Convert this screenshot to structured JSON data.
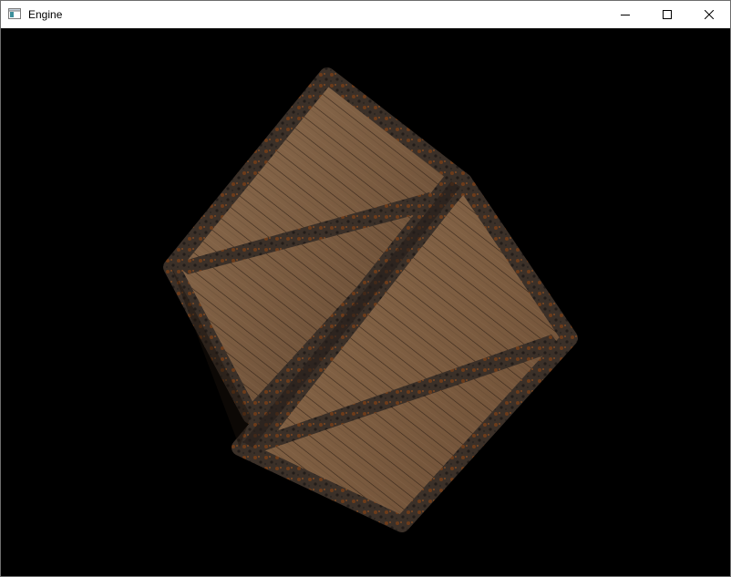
{
  "window": {
    "title": "Engine",
    "icons": {
      "app": "app-window-icon",
      "minimize": "minimize-icon",
      "maximize": "maximize-icon",
      "close": "close-icon"
    }
  },
  "scene": {
    "object": "wooden-crate",
    "background_color": "#000000",
    "colors": {
      "wood_light": "#8a6a4c",
      "wood_mid": "#6e5238",
      "wood_dark": "#3c2a1a",
      "metal_frame": "#3a2e24",
      "rust": "#8a4a1c"
    }
  }
}
